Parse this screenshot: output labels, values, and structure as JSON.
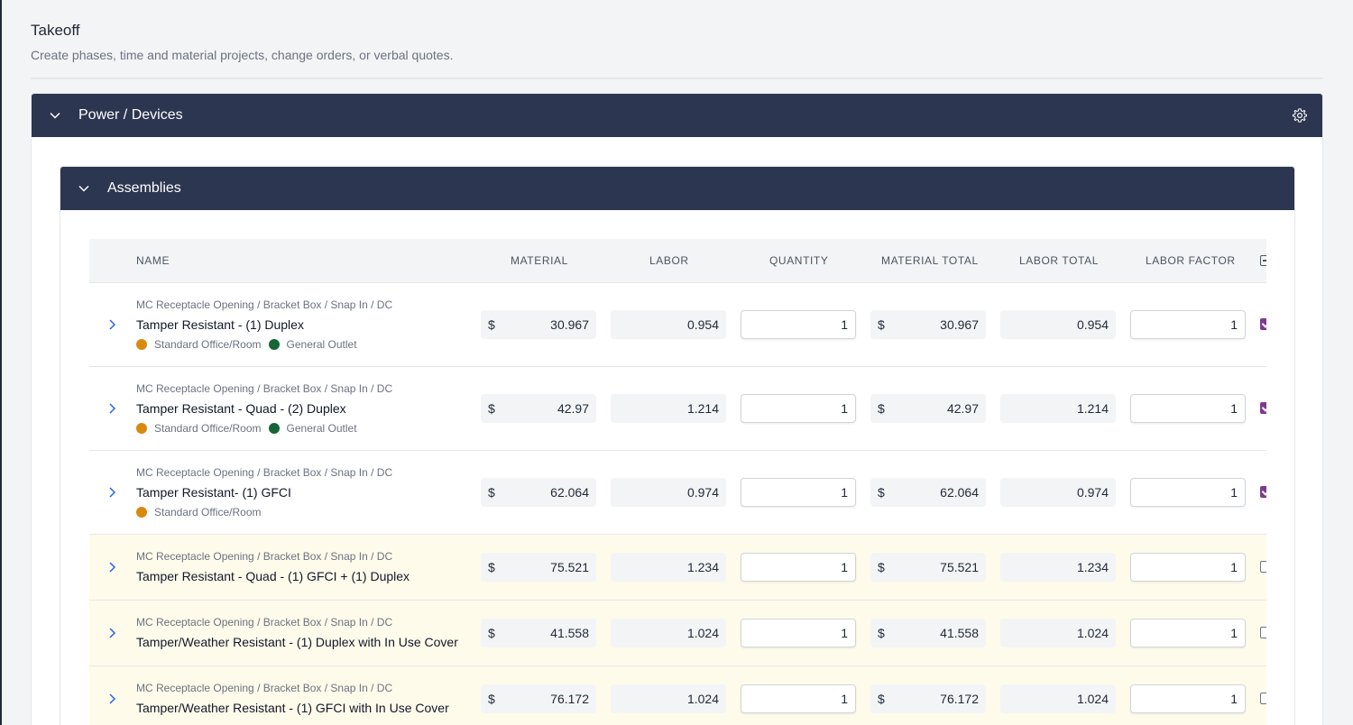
{
  "page": {
    "title": "Takeoff",
    "subtitle": "Create phases, time and material projects, change orders, or verbal quotes."
  },
  "section": {
    "title": "Power / Devices",
    "subsection": {
      "title": "Assemblies"
    }
  },
  "table": {
    "headers": {
      "name": "NAME",
      "material": "MATERIAL",
      "labor": "LABOR",
      "quantity": "QUANTITY",
      "material_total": "MATERIAL TOTAL",
      "labor_total": "LABOR TOTAL",
      "labor_factor": "LABOR FACTOR"
    },
    "currency": "$",
    "rows": [
      {
        "category": "MC Receptacle Opening / Bracket Box / Snap In / DC",
        "name": "Tamper Resistant - (1) Duplex",
        "tags": [
          "Standard Office/Room",
          "General Outlet"
        ],
        "material": "30.967",
        "labor": "0.954",
        "quantity": "1",
        "material_total": "30.967",
        "labor_total": "0.954",
        "labor_factor": "1",
        "checked": true
      },
      {
        "category": "MC Receptacle Opening / Bracket Box / Snap In / DC",
        "name": "Tamper Resistant - Quad - (2) Duplex",
        "tags": [
          "Standard Office/Room",
          "General Outlet"
        ],
        "material": "42.97",
        "labor": "1.214",
        "quantity": "1",
        "material_total": "42.97",
        "labor_total": "1.214",
        "labor_factor": "1",
        "checked": true
      },
      {
        "category": "MC Receptacle Opening / Bracket Box / Snap In / DC",
        "name": "Tamper Resistant- (1) GFCI",
        "tags": [
          "Standard Office/Room"
        ],
        "material": "62.064",
        "labor": "0.974",
        "quantity": "1",
        "material_total": "62.064",
        "labor_total": "0.974",
        "labor_factor": "1",
        "checked": true
      },
      {
        "category": "MC Receptacle Opening / Bracket Box / Snap In / DC",
        "name": "Tamper Resistant - Quad - (1) GFCI + (1) Duplex",
        "tags": [],
        "material": "75.521",
        "labor": "1.234",
        "quantity": "1",
        "material_total": "75.521",
        "labor_total": "1.234",
        "labor_factor": "1",
        "checked": false
      },
      {
        "category": "MC Receptacle Opening / Bracket Box / Snap In / DC",
        "name": "Tamper/Weather Resistant - (1) Duplex with In Use Cover",
        "tags": [],
        "material": "41.558",
        "labor": "1.024",
        "quantity": "1",
        "material_total": "41.558",
        "labor_total": "1.024",
        "labor_factor": "1",
        "checked": false
      },
      {
        "category": "MC Receptacle Opening / Bracket Box / Snap In / DC",
        "name": "Tamper/Weather Resistant - (1) GFCI with In Use Cover",
        "tags": [],
        "material": "76.172",
        "labor": "1.024",
        "quantity": "1",
        "material_total": "76.172",
        "labor_total": "1.024",
        "labor_factor": "1",
        "checked": false
      }
    ]
  },
  "colors": {
    "header_bg": "#2d3650",
    "tag_office": "#d9890e",
    "tag_outlet": "#166534",
    "checkbox_checked": "#7e3a8f",
    "highlight_row": "#fffbeb"
  }
}
